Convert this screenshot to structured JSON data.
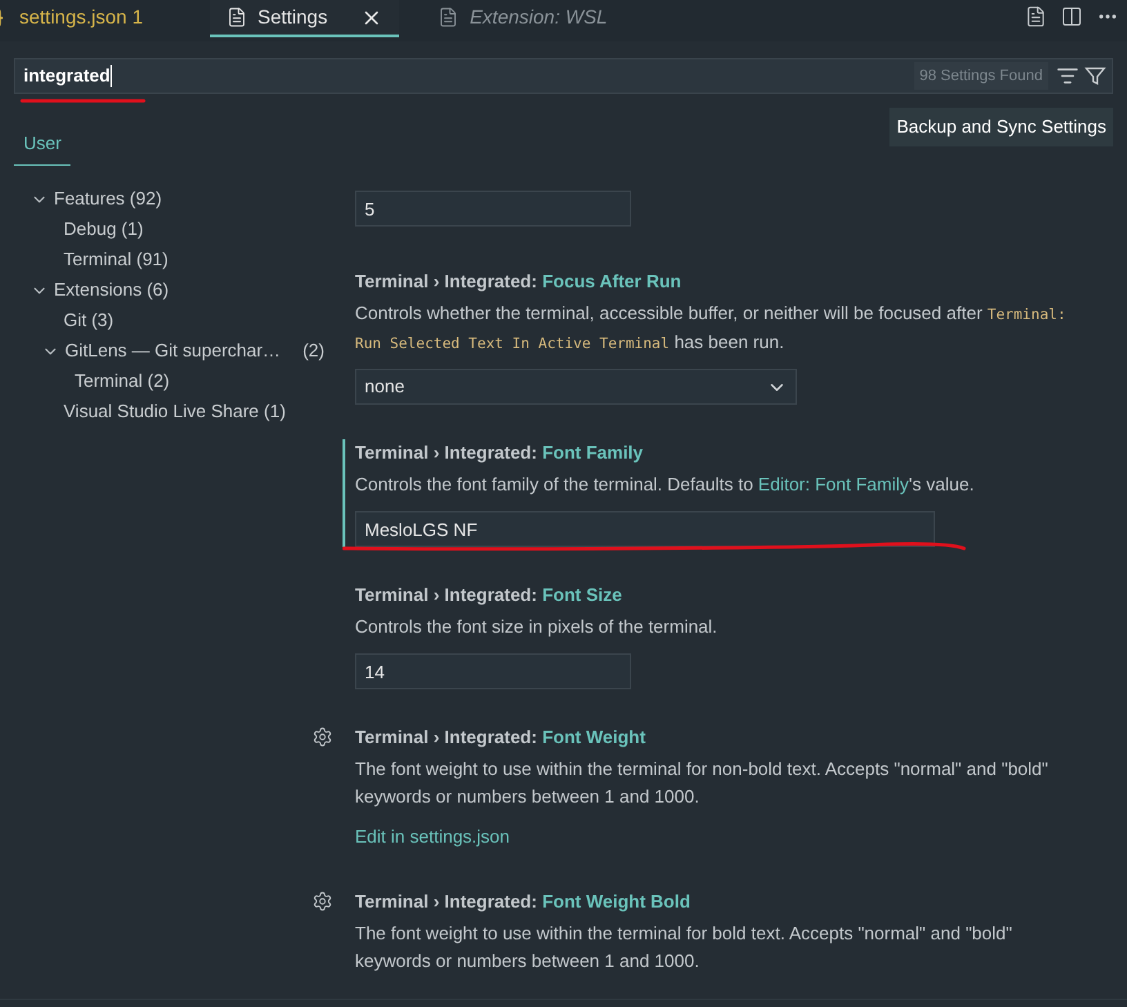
{
  "tabs": [
    {
      "label": "settings.json 1",
      "kind": "modified",
      "selected": false
    },
    {
      "label": "Settings",
      "kind": "settings",
      "selected": true
    },
    {
      "label": "Extension: WSL",
      "kind": "preview",
      "selected": false
    }
  ],
  "search": {
    "value": "integrated",
    "count": "98 Settings Found"
  },
  "scope_tabs": [
    {
      "label": "User",
      "selected": true
    }
  ],
  "backup_button": "Backup and Sync Settings",
  "tree": [
    {
      "label": "Features (92)",
      "expanded": true,
      "children": [
        {
          "label": "Debug (1)"
        },
        {
          "label": "Terminal (91)"
        }
      ]
    },
    {
      "label": "Extensions (6)",
      "expanded": true,
      "children": [
        {
          "label": "Git (3)"
        },
        {
          "label": "GitLens — Git superchar…",
          "count": "(2)",
          "expanded": true,
          "children": [
            {
              "label": "Terminal (2)"
            }
          ]
        },
        {
          "label": "Visual Studio Live Share (1)"
        }
      ]
    }
  ],
  "settings": [
    {
      "kind": "number",
      "value": "5",
      "focused": false,
      "gear": false
    },
    {
      "kind": "select",
      "category": "Terminal › Integrated:",
      "name": "Focus After Run",
      "description": [
        {
          "kind": "text",
          "text": "Controls whether the terminal, accessible buffer, or neither will be focused after "
        },
        {
          "kind": "code",
          "text": "Terminal: Run Selected Text In Active Terminal"
        },
        {
          "kind": "text",
          "text": " has been run."
        }
      ],
      "value": "none",
      "focused": false,
      "gear": false
    },
    {
      "kind": "text",
      "category": "Terminal › Integrated:",
      "name": "Font Family",
      "description": [
        {
          "kind": "text",
          "text": "Controls the font family of the terminal. Defaults to "
        },
        {
          "kind": "link",
          "text": "Editor: Font Family"
        },
        {
          "kind": "text",
          "text": "'s value."
        }
      ],
      "value": "MesloLGS NF",
      "focused": true,
      "gear": false
    },
    {
      "kind": "number",
      "category": "Terminal › Integrated:",
      "name": "Font Size",
      "description": [
        {
          "kind": "text",
          "text": "Controls the font size in pixels of the terminal."
        }
      ],
      "value": "14",
      "focused": false,
      "gear": false
    },
    {
      "kind": "edit",
      "category": "Terminal › Integrated:",
      "name": "Font Weight",
      "description": [
        {
          "kind": "text",
          "text": "The font weight to use within the terminal for non-bold text. Accepts \"normal\" and \"bold\" keywords or numbers between 1 and 1000."
        }
      ],
      "link": "Edit in settings.json",
      "focused": false,
      "gear": true
    },
    {
      "kind": "none",
      "category": "Terminal › Integrated:",
      "name": "Font Weight Bold",
      "description": [
        {
          "kind": "text",
          "text": "The font weight to use within the terminal for bold text. Accepts \"normal\" and \"bold\" keywords or numbers between 1 and 1000."
        }
      ],
      "focused": false,
      "gear": true
    }
  ]
}
